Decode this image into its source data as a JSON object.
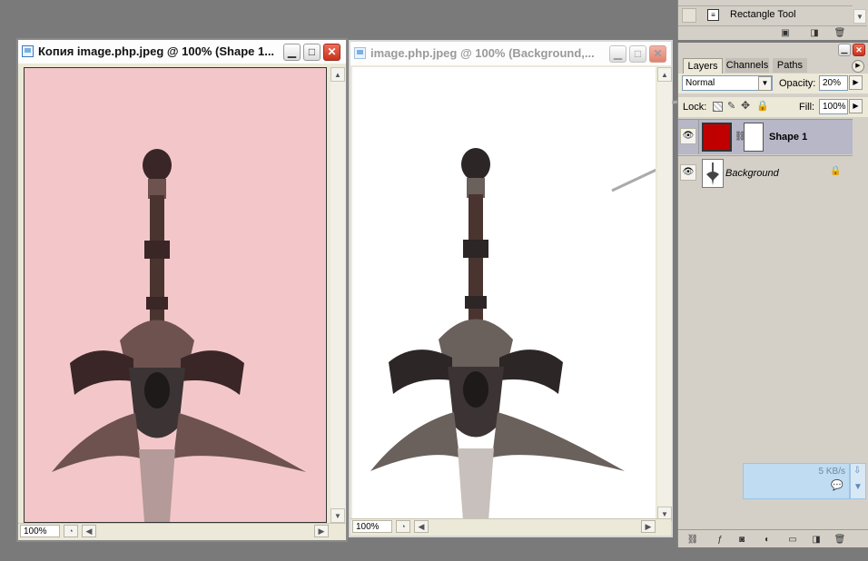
{
  "windows": {
    "copy": {
      "title": "Копия image.php.jpeg @ 100% (Shape 1...",
      "zoom": "100%",
      "overlay_color": "#f3c7c9"
    },
    "original": {
      "title": "image.php.jpeg @ 100% (Background,...",
      "zoom": "100%"
    }
  },
  "actions_panel": {
    "items": [
      {
        "label": "Rectangle Tool"
      }
    ]
  },
  "layers_panel": {
    "tabs": [
      "Layers",
      "Channels",
      "Paths"
    ],
    "active_tab": "Layers",
    "blend_mode": "Normal",
    "opacity_label": "Opacity:",
    "opacity_value": "20%",
    "lock_label": "Lock:",
    "fill_label": "Fill:",
    "fill_value": "100%",
    "layers": [
      {
        "name": "Shape 1",
        "selected": true,
        "thumb_color": "#c00000",
        "has_mask": true
      },
      {
        "name": "Background",
        "selected": false,
        "locked": true
      }
    ]
  },
  "network_widget": {
    "speed": "5 KB/s"
  },
  "colors": {
    "workspace": "#7a7a7a",
    "panel": "#d4d0c8",
    "selected_layer": "#b7b7c8",
    "shape_fill": "#c00000",
    "network_bg": "#bfdcf2"
  },
  "icons": {
    "window_icon": "photoshop-doc-icon",
    "minimize": "minimize-icon",
    "maximize": "maximize-icon",
    "close": "close-icon",
    "eye": "eye-icon",
    "lock": "lock-icon",
    "link": "chain-link-icon"
  }
}
